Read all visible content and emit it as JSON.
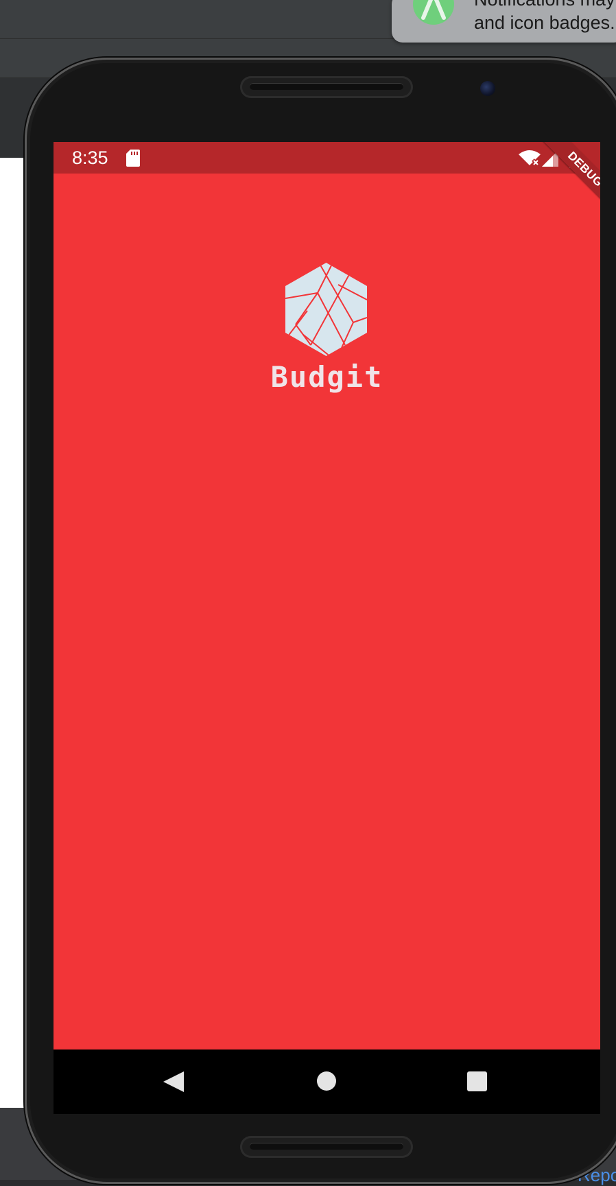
{
  "notification": {
    "line1": "Notifications may",
    "line2": "and icon badges."
  },
  "host": {
    "report_link": "Repo"
  },
  "status_bar": {
    "time": "8:35",
    "debug_banner": "DEBUG"
  },
  "app": {
    "name": "Budgit"
  },
  "colors": {
    "screen_background": "#f23538",
    "status_bar": "#b5272a",
    "logo_fill": "#d7e6ee",
    "app_name_text": "#f0e4e8"
  },
  "icons": {
    "status": [
      "sd-card-icon",
      "wifi-off-icon",
      "cell-signal-icon",
      "battery-icon"
    ],
    "nav": [
      "back-icon",
      "home-icon",
      "recents-icon"
    ],
    "logo": "hexagon-logo-icon",
    "notification": "android-studio-icon"
  }
}
